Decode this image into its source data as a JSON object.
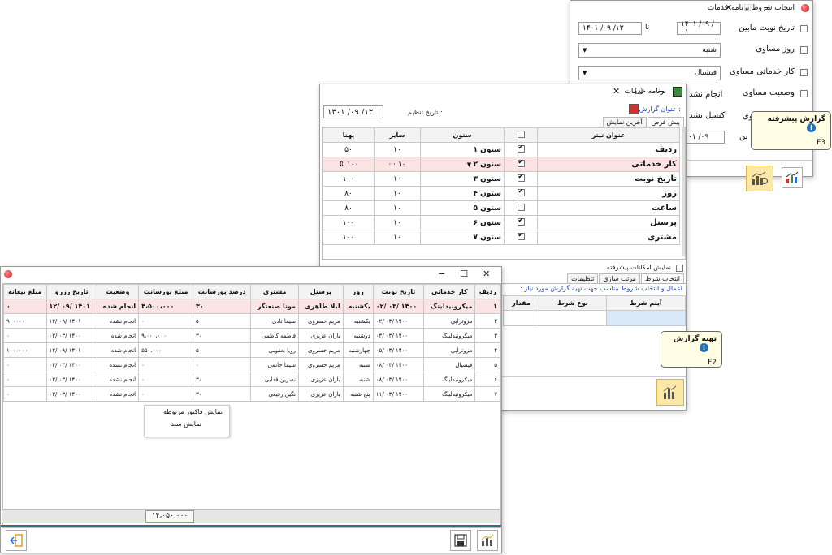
{
  "win1": {
    "title": "انتخاب شروط برنامه خدمات",
    "cond_date": "تاریخ نوبت مابین",
    "date_from": "۱۴۰۱ /۰۹ /۰۱",
    "date_sep": "تا",
    "date_to": "۱۴۰۱ /۰۹ /۱۳",
    "cond_day": "روز مساوی",
    "day_value": "شنبه",
    "cond_worker": "کار خدماتی مساوی",
    "worker_value": "فیشیال",
    "cond_status": "وضعیت مساوی",
    "row5_fragment": "انجام نشد",
    "row6_fragment": "کنسل نشد",
    "row6_suffix": "مساوی",
    "row7_value": "۰۱ /۰۹",
    "row7_suffix": "ین"
  },
  "tip_advanced": {
    "title": "گزارش پیشرفته",
    "key": "F3"
  },
  "win2": {
    "title": "برنامه خدمات",
    "settings_date_label": "تاریخ تنظیم :",
    "settings_date": "۱۴۰۱ /۰۹ /۱۳",
    "report_title_label": "عنوان گزارش :",
    "tabs": [
      "پیش فرض",
      "آخرین نمایش"
    ],
    "headers": {
      "title": "عنوان تیتر",
      "column": "ستون",
      "size": "سایز",
      "width": "پهنا"
    },
    "rows": [
      {
        "title": "ردیف",
        "checked": true,
        "column": "ستون ۱",
        "size": "۱۰",
        "width": "۵۰"
      },
      {
        "title": "کار خدماتی",
        "checked": true,
        "column": "ستون ۲",
        "size": "۱۰",
        "width": "۱۰۰"
      },
      {
        "title": "تاریخ نوبت",
        "checked": true,
        "column": "ستون ۳",
        "size": "۱۰",
        "width": "۱۰۰"
      },
      {
        "title": "روز",
        "checked": true,
        "column": "ستون ۴",
        "size": "۱۰",
        "width": "۸۰"
      },
      {
        "title": "ساعت",
        "checked": false,
        "column": "ستون ۵",
        "size": "۱۰",
        "width": "۸۰"
      },
      {
        "title": "پرسنل",
        "checked": true,
        "column": "ستون ۶",
        "size": "۱۰",
        "width": "۱۰۰"
      },
      {
        "title": "مشتری",
        "checked": true,
        "column": "ستون ۷",
        "size": "۱۰",
        "width": "۱۰۰"
      }
    ],
    "advanced_label": "نمایش امکانات پیشرفته",
    "bottom_tabs": [
      "انتخاب شرط",
      "مرتب سازی",
      "تنظیمات"
    ],
    "hint": "اعمال و انتخاب شروط مناسب جهت تهیه گزارش مورد نیاز :",
    "cond_headers": {
      "item": "آیتم شرط",
      "type": "نوع شرط",
      "value": "مقدار"
    }
  },
  "tip_prepare": {
    "title": "تهیه گزارش",
    "key": "F2"
  },
  "win3": {
    "headers": [
      "ردیف",
      "کار خدماتی",
      "تاریخ نوبت",
      "روز",
      "پرسنل",
      "مشتری",
      "درصد پورسانت",
      "مبلغ پورسانت",
      "وضعیت",
      "تاریخ رزرو",
      "مبلغ بیعانه"
    ],
    "rows": [
      [
        "۱",
        "میکرونیدلینگ",
        "۱۴۰۰ /۰۳ /۰۲",
        "یکشنبه",
        "لیلا طاهری",
        "مونا صنعتگر",
        "۳۰",
        "۴،۵۰۰،۰۰۰",
        "انجام شده",
        "۱۴۰۱ /۰۹ /۱۲",
        "۰"
      ],
      [
        "۲",
        "مزوتراپی",
        "۱۴۰۰ /۰۳ /۰۲",
        "یکشنبه",
        "مریم خسروی",
        "سیما نادی",
        "۵",
        "۰",
        "انجام نشده",
        "۱۴۰۱ /۰۹ /۱۲",
        "۹۰۰۰۰۰"
      ],
      [
        "۳",
        "میکرونیدلینگ",
        "۱۴۰۰ /۰۳ /۰۳",
        "دوشنبه",
        "باران عزیزی",
        "فاطمه کاظمی",
        "۳۰",
        "۹،۰۰۰،۰۰۰",
        "انجام شده",
        "۱۴۰۰ /۰۳ /۰۳",
        "۰"
      ],
      [
        "۴",
        "مزوتراپی",
        "۱۴۰۰ /۰۳ /۰۵",
        "چهارشنبه",
        "مریم خسروی",
        "رویا یعقوبی",
        "۵",
        "۵۵۰،۰۰۰",
        "انجام شده",
        "۱۴۰۱ /۰۹ /۱۲",
        "۱۰۰۰۰۰۰"
      ],
      [
        "۵",
        "فیشیال",
        "۱۴۰۰ /۰۳ /۰۸",
        "شنبه",
        "مریم خسروی",
        "شیما حاتمی",
        "۰",
        "۰",
        "انجام نشده",
        "۱۴۰۰ /۰۳ /۰۳",
        "۰"
      ],
      [
        "۶",
        "میکرونیدلینگ",
        "۱۴۰۰ /۰۳ /۰۸",
        "شنبه",
        "باران عزیزی",
        "نسرین قدایی",
        "۳۰",
        "۰",
        "انجام نشده",
        "۱۴۰۰ /۰۳ /۰۳",
        "۰"
      ],
      [
        "۷",
        "میکرونیدلینگ",
        "۱۴۰۰ /۰۳ /۱۱",
        "پنج شنبه",
        "باران عزیزی",
        "نگین رفیعی",
        "۳۰",
        "۰",
        "انجام نشده",
        "۱۴۰۰ /۰۳ /۰۳",
        "۰"
      ]
    ],
    "context_menu": [
      "نمایش فاکتور مربوطه",
      "نمایش سند"
    ],
    "total": "۱۴،۰۵۰،۰۰۰"
  }
}
